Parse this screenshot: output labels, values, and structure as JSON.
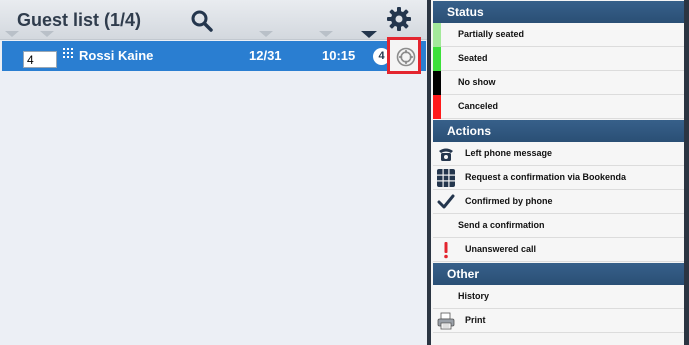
{
  "guest_list": {
    "title": "Guest list (1/4)",
    "icons": {
      "search": "search-icon",
      "settings": "gear-icon"
    },
    "row": {
      "party_input_value": "4",
      "name": "Rossi Kaine",
      "date": "12/31",
      "time": "10:15",
      "guest_count": "4",
      "icons": {
        "booking_source": "grid-icon",
        "status": "status-gear-icon"
      }
    }
  },
  "sidebar": {
    "status": {
      "header": "Status",
      "items": [
        {
          "label": "Partially seated",
          "color": "#a3e99a"
        },
        {
          "label": "Seated",
          "color": "#3ce03a"
        },
        {
          "label": "No show",
          "color": "#000000"
        },
        {
          "label": "Canceled",
          "color": "#ff1a1a"
        }
      ]
    },
    "actions": {
      "header": "Actions",
      "items": [
        {
          "label": "Left phone message",
          "icon": "phone-icon"
        },
        {
          "label": "Request a confirmation via Bookenda",
          "icon": "grid-icon"
        },
        {
          "label": "Confirmed by phone",
          "icon": "checkmark-icon"
        },
        {
          "label": "Send a confirmation",
          "icon": ""
        },
        {
          "label": "Unanswered call",
          "icon": "exclamation-icon"
        }
      ]
    },
    "other": {
      "header": "Other",
      "items": [
        {
          "label": "History",
          "icon": ""
        },
        {
          "label": "Print",
          "icon": "printer-icon"
        }
      ]
    }
  },
  "colors": {
    "row_highlight": "#2a7ed1",
    "section_header": "#2f5880",
    "selection_outline": "#e3252f"
  }
}
